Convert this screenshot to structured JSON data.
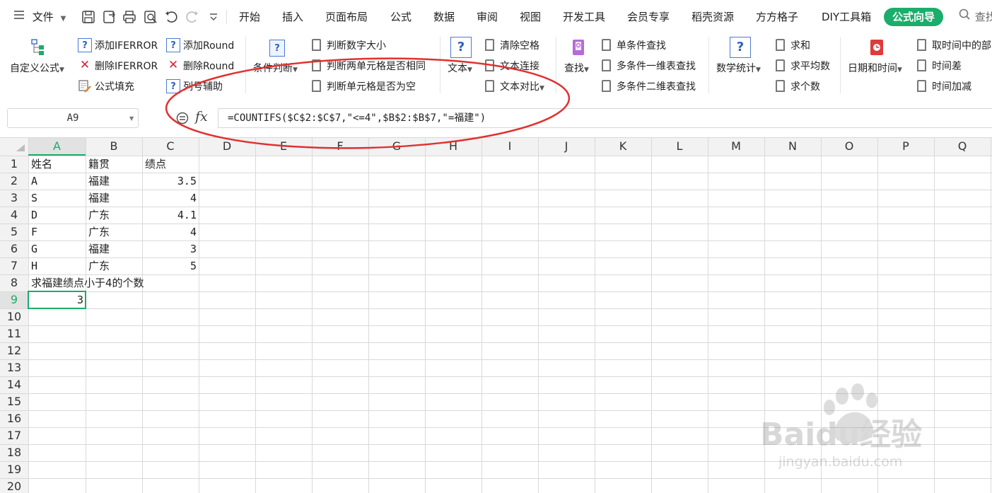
{
  "menu": {
    "file_label": "文件"
  },
  "tabs": [
    "开始",
    "插入",
    "页面布局",
    "公式",
    "数据",
    "审阅",
    "视图",
    "开发工具",
    "会员专享",
    "稻壳资源",
    "方方格子",
    "DIY工具箱",
    "公式向导"
  ],
  "search_label": "查找",
  "ribbon": {
    "custom_formula": "自定义公式",
    "add_iferror": "添加IFERROR",
    "del_iferror": "删除IFERROR",
    "formula_fill": "公式填充",
    "add_round": "添加Round",
    "del_round": "删除Round",
    "col_assist": "列号辅助",
    "cond_judge": "条件判断",
    "judge_num": "判断数字大小",
    "judge_same": "判断两单元格是否相同",
    "judge_empty": "判断单元格是否为空",
    "text": "文本",
    "clear_space": "清除空格",
    "text_join": "文本连接",
    "text_compare": "文本对比",
    "find": "查找",
    "single_find": "单条件查找",
    "multi_1d": "多条件一维表查找",
    "multi_2d": "多条件二维表查找",
    "math_stats": "数学统计",
    "sum": "求和",
    "avg": "求平均数",
    "count": "求个数",
    "date_time": "日期和时间",
    "time_part": "取时间中的部",
    "time_diff": "时间差",
    "time_add": "时间加减"
  },
  "formula_bar": {
    "name_box": "A9",
    "fx": "fx",
    "formula": "=COUNTIFS($C$2:$C$7,\"<=4\",$B$2:$B$7,\"=福建\")"
  },
  "sheet": {
    "columns": [
      "A",
      "B",
      "C",
      "D",
      "E",
      "F",
      "G",
      "H",
      "I",
      "J",
      "K",
      "L",
      "M",
      "N",
      "O",
      "P",
      "Q"
    ],
    "rows": [
      "1",
      "2",
      "3",
      "4",
      "5",
      "6",
      "7",
      "8",
      "9",
      "10",
      "11",
      "12",
      "13",
      "14",
      "15",
      "16",
      "17",
      "18",
      "19",
      "20"
    ],
    "active_cell": "A9",
    "cells": {
      "A1": "姓名",
      "B1": "籍贯",
      "C1": "绩点",
      "A2": "A",
      "B2": "福建",
      "C2": "3.5",
      "A3": "S",
      "B3": "福建",
      "C3": "4",
      "A4": "D",
      "B4": "广东",
      "C4": "4.1",
      "A5": "F",
      "B5": "广东",
      "C5": "4",
      "A6": "G",
      "B6": "福建",
      "C6": "3",
      "A7": "H",
      "B7": "广东",
      "C7": "5",
      "A8": "求福建绩点小于4的个数",
      "A9": "3"
    }
  },
  "watermark": {
    "brand": "Baidu经验",
    "url": "jingyan.baidu.com"
  },
  "colors": {
    "accent": "#1aad6b",
    "annotation": "#e03131",
    "header_bg": "#f2f2f2",
    "active_header_bg": "#e2e2e2",
    "grid": "#d9d9d9"
  }
}
